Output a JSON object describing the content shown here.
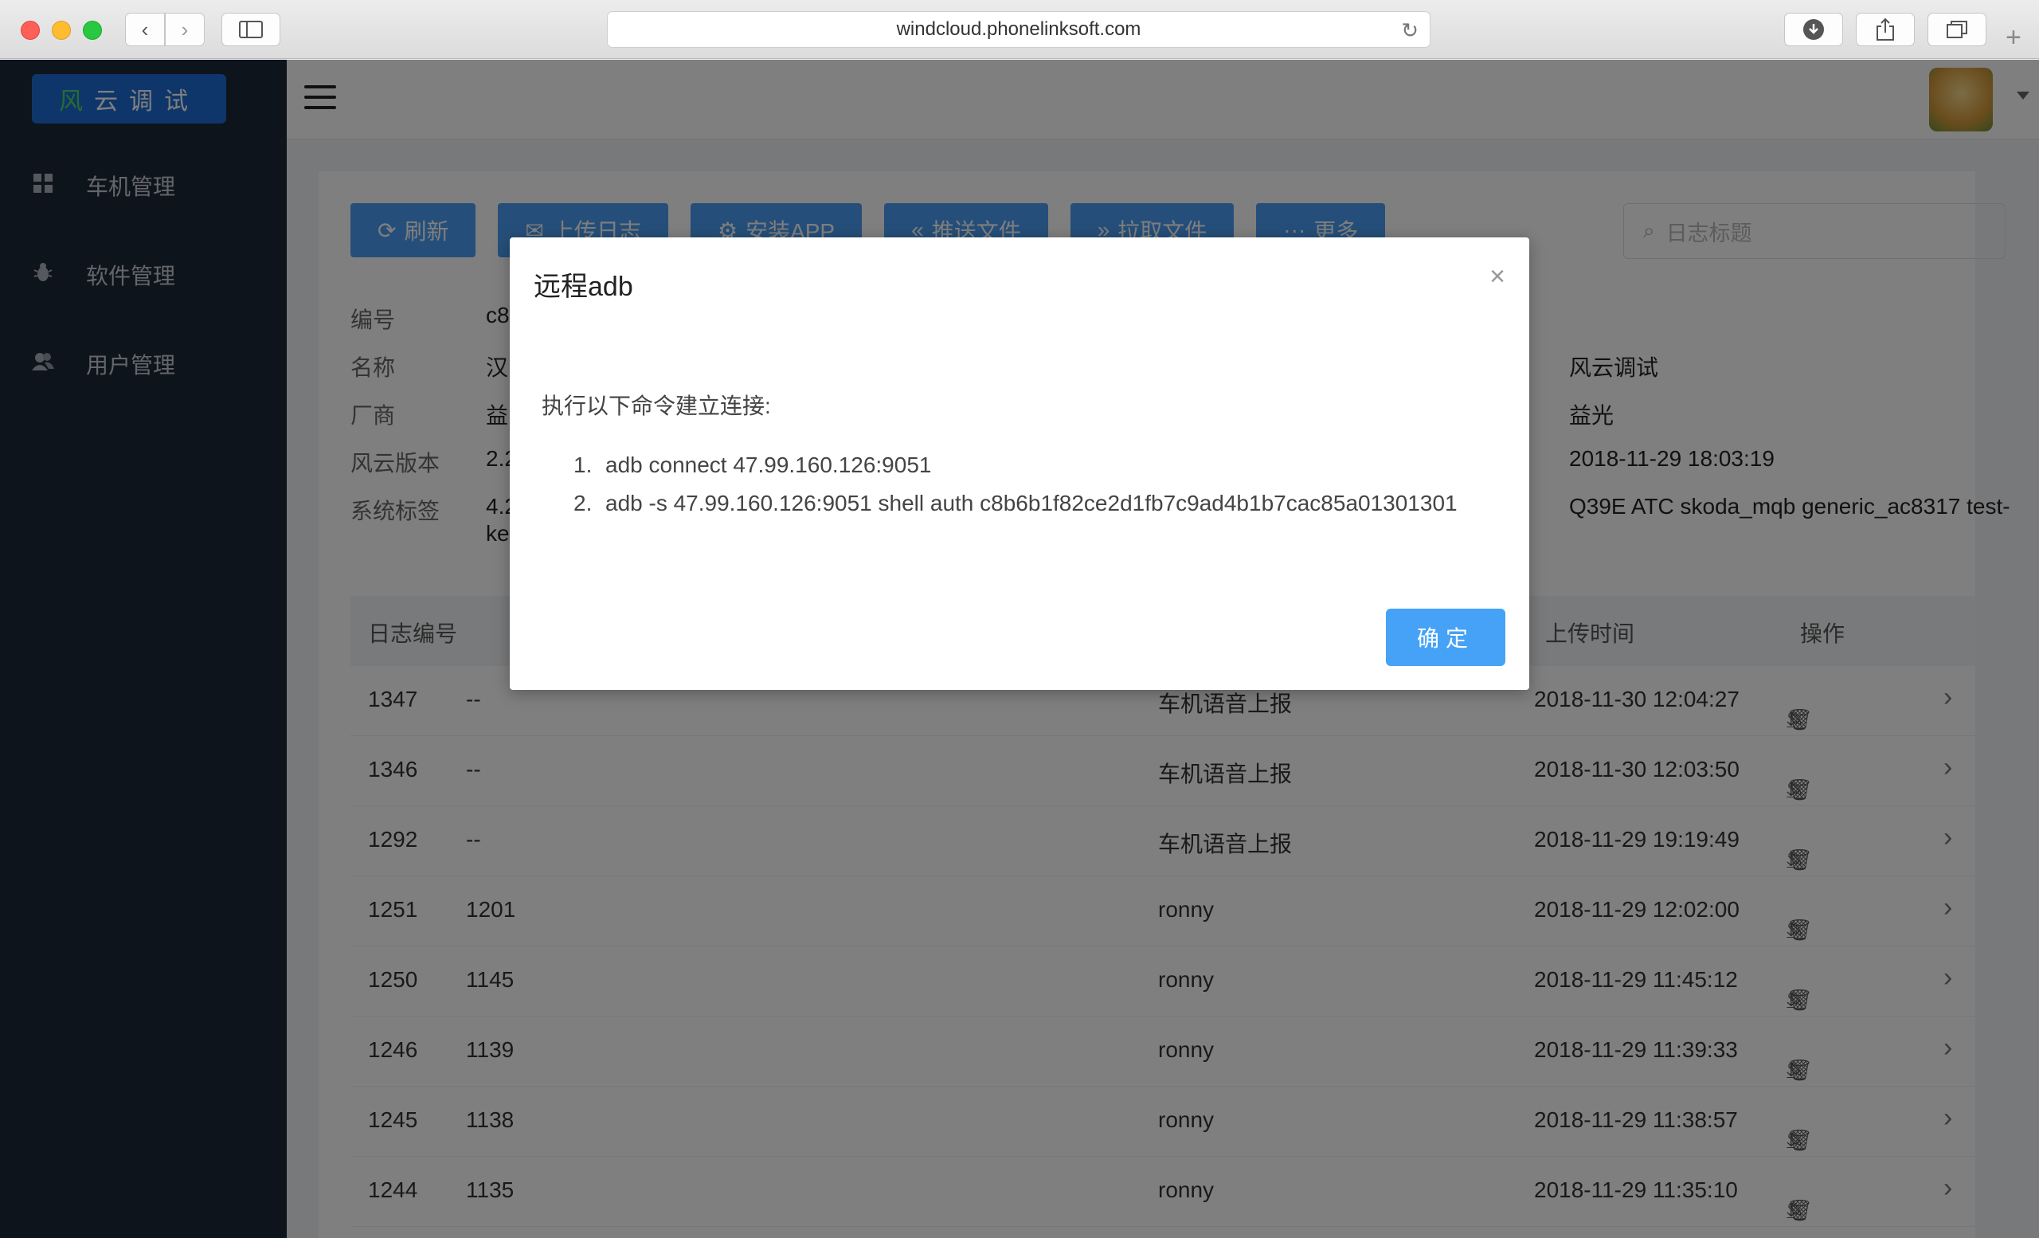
{
  "browser": {
    "url": "windcloud.phonelinksoft.com"
  },
  "sidebar": {
    "logo": "风云调试",
    "logo_first": "风",
    "logo_rest": "云调试",
    "items": [
      {
        "label": "车机管理",
        "icon": "grid-icon"
      },
      {
        "label": "软件管理",
        "icon": "bug-icon"
      },
      {
        "label": "用户管理",
        "icon": "users-icon"
      }
    ]
  },
  "toolbar": {
    "buttons": [
      {
        "label": "刷新",
        "icon": "refresh-icon",
        "glyph": "⟳"
      },
      {
        "label": "上传日志",
        "icon": "mail-icon",
        "glyph": "✉"
      },
      {
        "label": "安装APP",
        "icon": "gear-icon",
        "glyph": "⚙"
      },
      {
        "label": "推送文件",
        "icon": "double-left-icon",
        "glyph": "«"
      },
      {
        "label": "拉取文件",
        "icon": "double-right-icon",
        "glyph": "»"
      },
      {
        "label": "更多",
        "icon": "more-icon",
        "glyph": "···"
      }
    ],
    "search_placeholder": "日志标题"
  },
  "info": [
    {
      "label": "编号",
      "value": "c8",
      "value2": ""
    },
    {
      "label": "名称",
      "value": "汉",
      "value2": "风云调试"
    },
    {
      "label": "厂商",
      "value": "益",
      "value2": "益光"
    },
    {
      "label": "风云版本",
      "value": "2.2",
      "value2": "2018-11-29 18:03:19"
    },
    {
      "label": "系统标签",
      "value": "4.2",
      "value2": "Q39E ATC skoda_mqb generic_ac8317 test-"
    }
  ],
  "info_tag_cont": "ke",
  "table": {
    "headers": {
      "id": "日志编号",
      "time": "上传时间",
      "ops": "操作"
    },
    "rows": [
      {
        "id": "1347",
        "title": "--",
        "source": "车机语音上报",
        "time": "2018-11-30 12:04:27"
      },
      {
        "id": "1346",
        "title": "--",
        "source": "车机语音上报",
        "time": "2018-11-30 12:03:50"
      },
      {
        "id": "1292",
        "title": "--",
        "source": "车机语音上报",
        "time": "2018-11-29 19:19:49"
      },
      {
        "id": "1251",
        "title": "1201",
        "source": "ronny",
        "time": "2018-11-29 12:02:00"
      },
      {
        "id": "1250",
        "title": "1145",
        "source": "ronny",
        "time": "2018-11-29 11:45:12"
      },
      {
        "id": "1246",
        "title": "1139",
        "source": "ronny",
        "time": "2018-11-29 11:39:33"
      },
      {
        "id": "1245",
        "title": "1138",
        "source": "ronny",
        "time": "2018-11-29 11:38:57"
      },
      {
        "id": "1244",
        "title": "1135",
        "source": "ronny",
        "time": "2018-11-29 11:35:10"
      }
    ]
  },
  "modal": {
    "title": "远程adb",
    "intro": "执行以下命令建立连接:",
    "commands": [
      "adb connect 47.99.160.126:9051",
      "adb -s 47.99.160.126:9051 shell auth c8b6b1f82ce2d1fb7c9ad4b1b7cac85a01301301"
    ],
    "ok_label": "确定"
  }
}
